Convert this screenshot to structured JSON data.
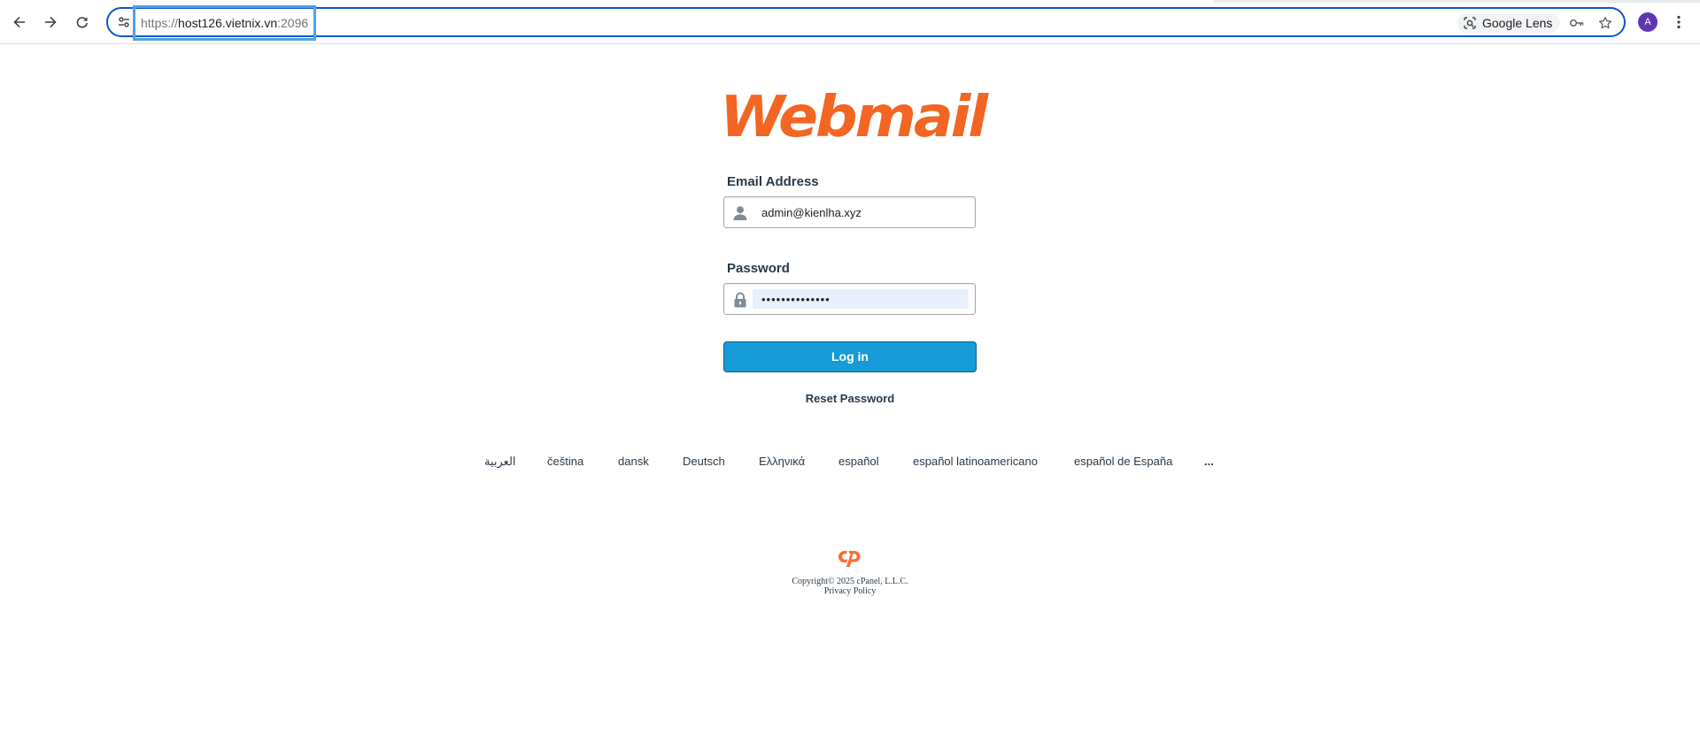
{
  "browser": {
    "url_scheme": "https://",
    "url_host": "host126.vietnix.vn",
    "url_port": ":2096",
    "lens_label": "Google Lens",
    "profile_initial": "A"
  },
  "icons": {
    "back": "arrow-left-icon",
    "forward": "arrow-right-icon",
    "reload": "reload-icon",
    "site_info": "tune-icon",
    "lens": "camera-lens-icon",
    "password_key": "key-icon",
    "bookmark": "star-icon",
    "menu": "three-dots-icon",
    "email": "user-icon",
    "password": "lock-icon"
  },
  "logo": {
    "text": "Webmail",
    "color": "#f26522"
  },
  "form": {
    "email_label": "Email Address",
    "email_value": "admin@kienlha.xyz",
    "password_label": "Password",
    "password_value": "••••••••••••••",
    "login_label": "Log in"
  },
  "reset_label": "Reset Password",
  "languages": [
    "العربية",
    "čeština",
    "dansk",
    "Deutsch",
    "Ελληνικά",
    "español",
    "español latinoamericano",
    "español de España",
    "..."
  ],
  "footer": {
    "copyright": "Copyright© 2025 cPanel, L.L.C.",
    "privacy": "Privacy Policy",
    "brand_color": "#ff6c2c"
  },
  "colors": {
    "accent_button": "#179bd7",
    "omnibox_border": "#0b57d0",
    "url_highlight": "#4ea1ee",
    "text": "#293a4a"
  }
}
